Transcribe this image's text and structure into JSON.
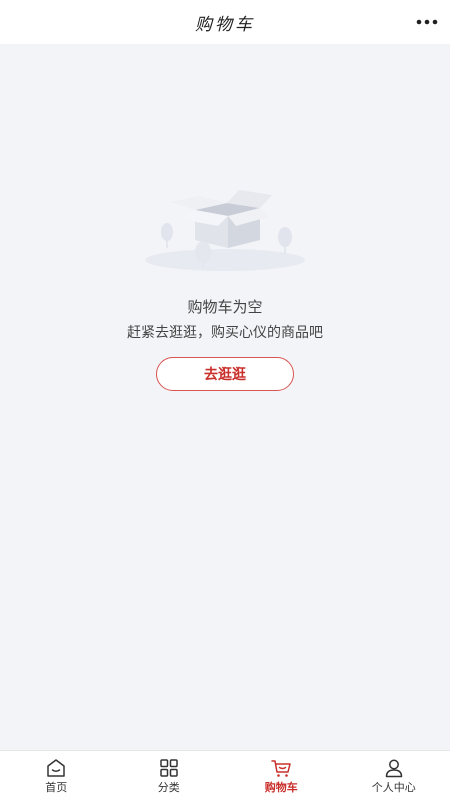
{
  "header": {
    "title": "购物车",
    "more_icon": "more-dots-icon"
  },
  "empty_state": {
    "illustration": "empty-box-icon",
    "title": "购物车为空",
    "subtitle": "赶紧去逛逛，购买心仪的商品吧",
    "button_label": "去逛逛"
  },
  "tabbar": {
    "items": [
      {
        "label": "首页",
        "icon": "home-icon",
        "active": false
      },
      {
        "label": "分类",
        "icon": "category-grid-icon",
        "active": false
      },
      {
        "label": "购物车",
        "icon": "cart-icon",
        "active": true
      },
      {
        "label": "个人中心",
        "icon": "user-icon",
        "active": false
      }
    ]
  },
  "colors": {
    "accent": "#c9302c",
    "background": "#f3f4f8",
    "surface": "#ffffff"
  }
}
